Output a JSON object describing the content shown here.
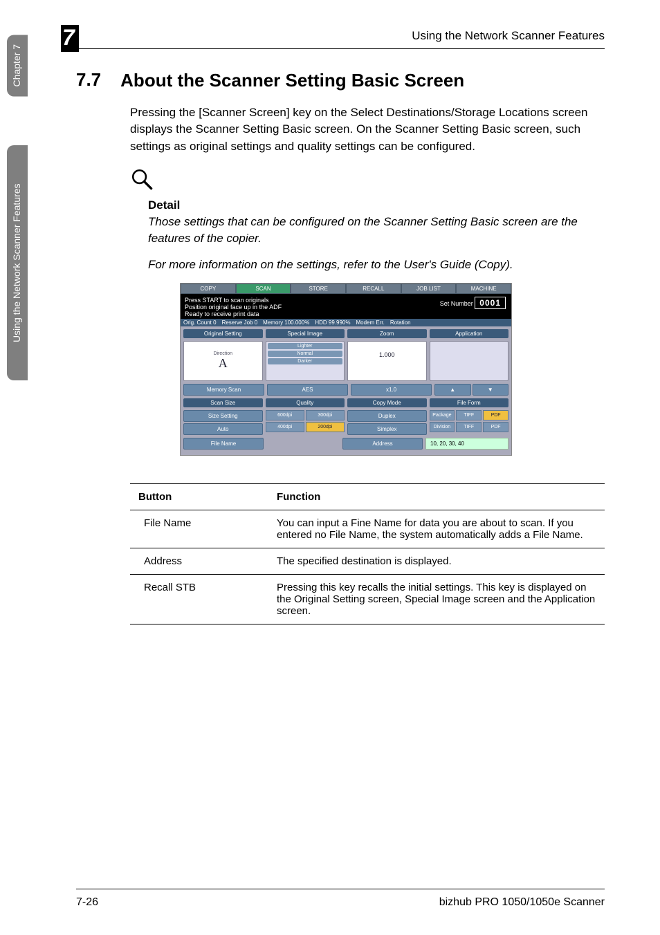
{
  "chapter_tab": "Chapter 7",
  "feature_tab": "Using the Network Scanner Features",
  "chapter_badge": "7",
  "running_head": "Using the Network Scanner Features",
  "section": {
    "num": "7.7",
    "title": "About the Scanner Setting Basic Screen",
    "intro": "Pressing the [Scanner Screen] key on the Select Destinations/Storage Locations screen displays the Scanner Setting Basic screen. On the Scanner Setting Basic screen, such settings as original settings and quality settings can be configured."
  },
  "detail": {
    "label": "Detail",
    "line1": "Those settings that can be configured on the Scanner Setting Basic screen are the features of the copier.",
    "line2": "For more information on the settings, refer to the User's Guide (Copy)."
  },
  "screenshot": {
    "tabs": [
      "COPY",
      "SCAN",
      "STORE",
      "RECALL",
      "JOB LIST",
      "MACHINE"
    ],
    "active_tab": 1,
    "info_line1": "Press START to scan originals",
    "info_line2": "Position original face up in the ADF",
    "info_line3": "Ready to receive print data",
    "set_number_label": "Set Number",
    "set_number": "0001",
    "bar": {
      "orig_count": "Orig. Count  0",
      "reserve": "Reserve Job  0",
      "memory": "Memory  100.000%",
      "hdd": "HDD  99.990%",
      "modem": "Modem Err.",
      "rotation": "Rotation"
    },
    "panel_tabs": [
      "Original Setting",
      "Special Image",
      "Zoom",
      "Application"
    ],
    "direction": {
      "label": "Direction",
      "value": "A"
    },
    "density": [
      "Lighter",
      "Normal",
      "Darker"
    ],
    "zoom_value": "1.000",
    "row2": {
      "memory_scan": "Memory Scan",
      "aes": "AES",
      "x1": "x1.0",
      "up": "▲",
      "down": "▼"
    },
    "group_headers": [
      "Scan Size",
      "Quality",
      "Copy Mode",
      "File Form"
    ],
    "size_setting": {
      "label": "Size Setting",
      "auto": "Auto"
    },
    "quality_grid": [
      "600dpi",
      "300dpi",
      "400dpi",
      "200dpi"
    ],
    "copy_mode": [
      "Duplex",
      "Simplex"
    ],
    "file_form": {
      "package": "Package",
      "division": "Division",
      "tiff": "TIFF",
      "pdf": "PDF"
    },
    "file_name": "File Name",
    "address_label": "Address",
    "address_value": "10, 20, 30, 40"
  },
  "table": {
    "head_button": "Button",
    "head_function": "Function",
    "rows": [
      {
        "button": "File Name",
        "function": "You can input a Fine Name for data you are about to scan. If you entered no File Name, the system automatically adds a File Name."
      },
      {
        "button": "Address",
        "function": "The specified destination is displayed."
      },
      {
        "button": "Recall STB",
        "function": "Pressing this key recalls the initial settings. This key is displayed on the Original Setting screen, Special Image screen and the Application screen."
      }
    ]
  },
  "footer": {
    "page": "7-26",
    "product": "bizhub PRO 1050/1050e Scanner"
  }
}
